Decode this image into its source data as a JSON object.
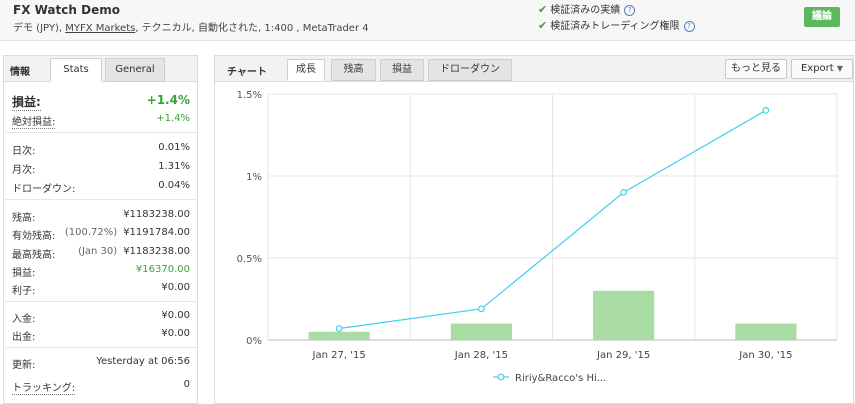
{
  "account": {
    "name": "FX Watch  Demo",
    "sub_prefix": "デモ (JPY), ",
    "broker": "MYFX Markets",
    "sub_suffix": ", テクニカル, 自動化された, 1:400 , MetaTrader 4",
    "verified_track": "検証済みの実績",
    "verified_privileges": "検証済みトレーディング権限",
    "discuss_button": "議論"
  },
  "info_panel": {
    "title": "情報",
    "tabs": [
      "Stats",
      "General"
    ],
    "gain_label": "損益:",
    "gain_value": "+1.4%",
    "abs_gain_label": "絶対損益:",
    "abs_gain_value": "+1.4%",
    "daily_label": "日次:",
    "daily_value": "0.01%",
    "monthly_label": "月次:",
    "monthly_value": "1.31%",
    "drawdown_label": "ドローダウン:",
    "drawdown_value": "0.04%",
    "balance_label": "残高:",
    "balance_value": "¥1183238.00",
    "equity_label": "有効残高:",
    "equity_note": "(100.72%)",
    "equity_value": "¥1191784.00",
    "highest_label": "最高残高:",
    "highest_note": "(Jan 30)",
    "highest_value": "¥1183238.00",
    "profit_label": "損益:",
    "profit_value": "¥16370.00",
    "interest_label": "利子:",
    "interest_value": "¥0.00",
    "deposits_label": "入金:",
    "deposits_value": "¥0.00",
    "withdrawals_label": "出金:",
    "withdrawals_value": "¥0.00",
    "updated_label": "更新:",
    "updated_value": "Yesterday at 06:56",
    "tracking_label": "トラッキング:",
    "tracking_value": "0"
  },
  "chart_panel": {
    "title": "チャート",
    "tabs": [
      "成長",
      "残高",
      "損益",
      "ドローダウン"
    ],
    "more_button": "もっと見る",
    "export_button": "Export"
  },
  "colors": {
    "line": "#3fd0ef",
    "bar": "#a9dca3",
    "positive": "#3aa335",
    "button_green": "#5cb85c"
  },
  "chart_data": {
    "type": "line",
    "categories": [
      "Jan 27, '15",
      "Jan 28, '15",
      "Jan 29, '15",
      "Jan 30, '15"
    ],
    "y_tick_labels": [
      "0%",
      "0.5%",
      "1%",
      "1.5%"
    ],
    "ylim": [
      0,
      1.5
    ],
    "grid": true,
    "legend_position": "bottom",
    "series": [
      {
        "name": "Ririy&Racco's Hi...",
        "type": "line",
        "values": [
          0.07,
          0.19,
          0.9,
          1.4
        ]
      },
      {
        "type": "bar",
        "values": [
          0.05,
          0.1,
          0.3,
          0.1
        ]
      }
    ]
  }
}
